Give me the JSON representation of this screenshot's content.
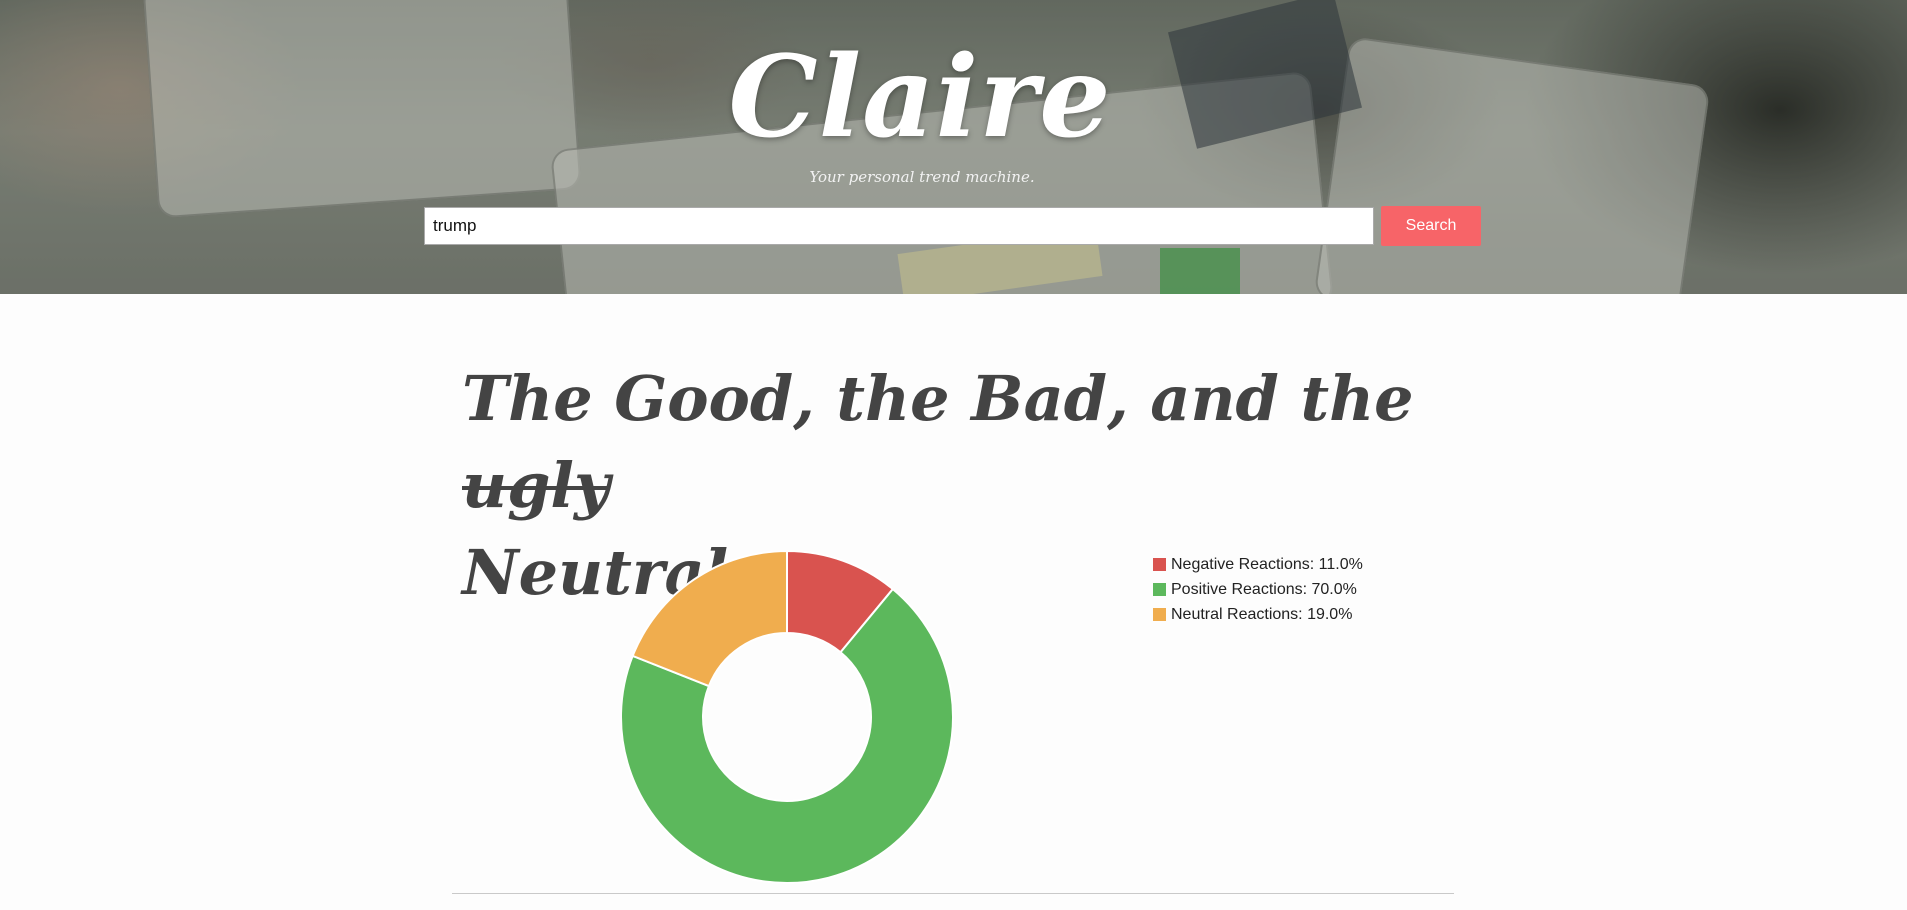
{
  "header": {
    "logo": "Claire",
    "tagline": "Your personal trend machine."
  },
  "search": {
    "value": "trump",
    "button_label": "Search"
  },
  "headline": {
    "part1": "The Good, the Bad, and the",
    "struck": "ugly",
    "part2": "Neutral"
  },
  "chart_data": {
    "type": "pie",
    "donut": true,
    "legend_position": "right",
    "categories": [
      "Negative Reactions",
      "Positive Reactions",
      "Neutral Reactions"
    ],
    "values": [
      11.0,
      70.0,
      19.0
    ],
    "colors": [
      "#d9534f",
      "#5cb85c",
      "#f0ad4e"
    ],
    "legend_labels": [
      "Negative Reactions: 11.0%",
      "Positive Reactions: 70.0%",
      "Neutral Reactions: 19.0%"
    ]
  }
}
